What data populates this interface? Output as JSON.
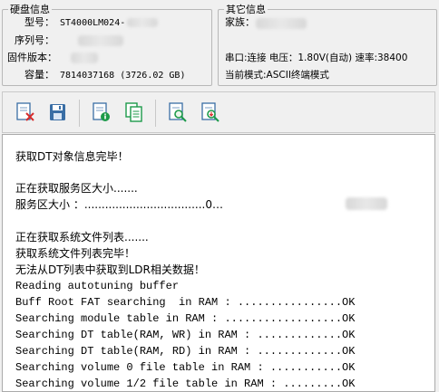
{
  "disk_info": {
    "title": "硬盘信息",
    "model_label": "型号：",
    "model_value": "ST4000LM024-",
    "serial_label": "序列号：",
    "firmware_label": "固件版本：",
    "capacity_label": "容量：",
    "capacity_value": "7814037168 (3726.02 GB)"
  },
  "other_info": {
    "title": "其它信息",
    "family_label": "家族：",
    "serial_port_line": "串口:连接 电压：1.80V(自动) 速率:38400",
    "mode_line": "当前模式:ASCII终端模式"
  },
  "toolbar": {
    "buttons": [
      {
        "icon": "clear-log-icon"
      },
      {
        "icon": "save-icon"
      },
      {
        "icon": "view-info-icon"
      },
      {
        "icon": "copy-icon"
      },
      {
        "icon": "search-icon"
      },
      {
        "icon": "search-download-icon"
      }
    ]
  },
  "log": {
    "lines": [
      "获取DT对象信息完毕！",
      "",
      "正在获取服务区大小.......",
      "服务区大小 ：...................................0…",
      "",
      "正在获取系统文件列表.......",
      "获取系统文件列表完毕！",
      "无法从DT列表中获取到LDR相关数据！",
      "Reading autotuning buffer",
      "Buff Root FAT searching  in RAM : ................OK",
      "Searching module table in RAM : ..................OK",
      "Searching DT table(RAM, WR) in RAM : .............OK",
      "Searching DT table(RAM, RD) in RAM : .............OK",
      "Searching volume 0 file table in RAM : ...........OK",
      "Searching volume 1/2 file table in RAM : .........OK"
    ]
  }
}
